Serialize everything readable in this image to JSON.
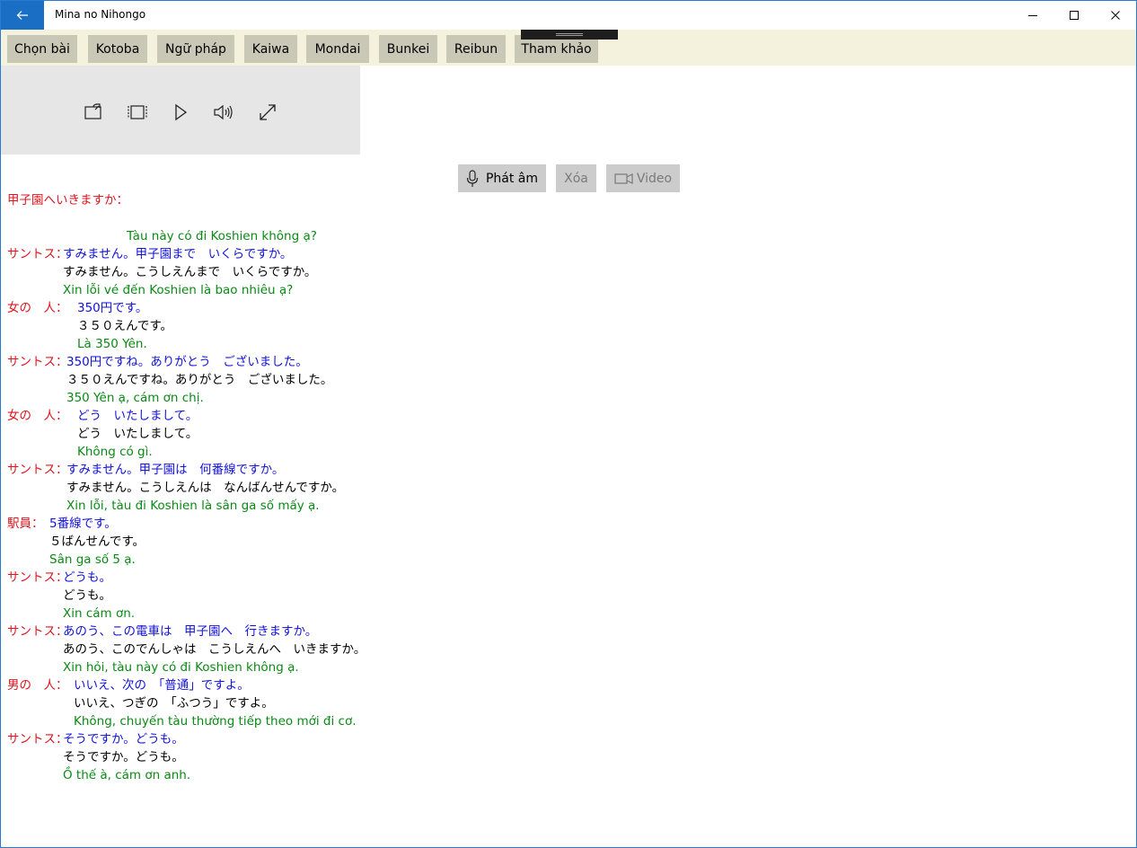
{
  "window": {
    "title": "Mina no Nihongo"
  },
  "icons": {
    "back": "back-arrow-icon",
    "minimize": "minimize-icon",
    "maximize": "maximize-icon",
    "close": "close-icon",
    "cast": "cast-icon",
    "aspect": "aspect-ratio-icon",
    "play": "play-icon",
    "volume": "volume-icon",
    "fullscreen": "fullscreen-icon",
    "mic": "microphone-icon",
    "video": "video-camera-icon"
  },
  "colors": {
    "accent": "#1a6fc4",
    "tab_bar": "#f4f2dc",
    "tab": "#c9c8b6",
    "speaker": "#e0141e",
    "japanese": "#1212d8",
    "reading": "#000000",
    "vietnamese": "#0a8a14"
  },
  "tabs": [
    "Chọn bài",
    "Kotoba",
    "Ngữ pháp",
    "Kaiwa",
    "Mondai",
    "Bunkei",
    "Reibun",
    "Tham khảo"
  ],
  "actions": {
    "record": "Phát âm",
    "delete": "Xóa",
    "video": "Video"
  },
  "dialog": {
    "title": "甲子園へいきますか：",
    "intro_vi": "Tàu này có đi Koshien không ạ?",
    "lines": [
      {
        "speaker": "サントス：",
        "jp": "すみません。甲子園まで　いくらですか。",
        "kana": "すみません。こうしえんまで　いくらですか。",
        "vi": "Xin lỗi vé đến Koshien là bao nhiêu ạ?"
      },
      {
        "speaker": "女の　人：",
        "jp": "350円です。",
        "kana": "３５０えんです。",
        "vi": "Là 350 Yên."
      },
      {
        "speaker": "サントス：",
        "jp": "350円ですね。ありがとう　ございました。",
        "kana": "３５０えんですね。ありがとう　ございました。",
        "vi": "350 Yên ạ, cám ơn chị."
      },
      {
        "speaker": "女の　人：",
        "jp": "どう　いたしまして。",
        "kana": "どう　いたしまして。",
        "vi": "Không có gì."
      },
      {
        "speaker": "サントス：",
        "jp": "すみません。甲子園は　何番線ですか。",
        "kana": "すみません。こうしえんは　なんばんせんですか。",
        "vi": "Xin lỗi, tàu đi Koshien là sân ga số mấy ạ."
      },
      {
        "speaker": "駅員：",
        "jp": "5番線です。",
        "kana": "５ばんせんです。",
        "vi": "Sân ga số 5 ạ."
      },
      {
        "speaker": "サントス：",
        "jp": "どうも。",
        "kana": "どうも。",
        "vi": "Xin cám ơn."
      },
      {
        "speaker": "サントス：",
        "jp": "あのう、この電車は　甲子園へ　行きますか。",
        "kana": "あのう、このでんしゃは　こうしえんへ　いきますか。",
        "vi": "Xin hỏi, tàu này có đi Koshien không ạ."
      },
      {
        "speaker": "男の　人：",
        "jp": "いいえ、次の　「普通」ですよ。",
        "kana": "いいえ、つぎの　「ふつう」ですよ。",
        "vi": "Không, chuyến tàu thường tiếp theo mới đi cơ."
      },
      {
        "speaker": "サントス：",
        "jp": "そうですか。どうも。",
        "kana": "そうですか。どうも。",
        "vi": "Ồ thế à, cám ơn anh."
      }
    ]
  }
}
